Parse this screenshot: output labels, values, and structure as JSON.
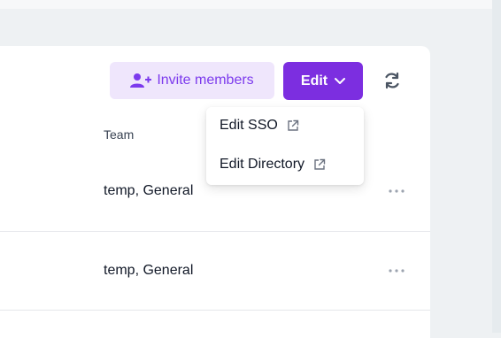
{
  "toolbar": {
    "invite_label": "Invite members",
    "invite_icon": "user-plus-icon",
    "edit_label": "Edit",
    "edit_icon": "chevron-down-icon",
    "refresh_icon": "refresh-icon",
    "accent_color": "#7c2ee0"
  },
  "dropdown": {
    "items": [
      {
        "label": "Edit SSO",
        "icon": "external-link-icon"
      },
      {
        "label": "Edit Directory",
        "icon": "external-link-icon"
      }
    ]
  },
  "table": {
    "columns": [
      "Team"
    ],
    "rows": [
      {
        "team": "temp, General"
      },
      {
        "team": "temp, General"
      }
    ]
  }
}
